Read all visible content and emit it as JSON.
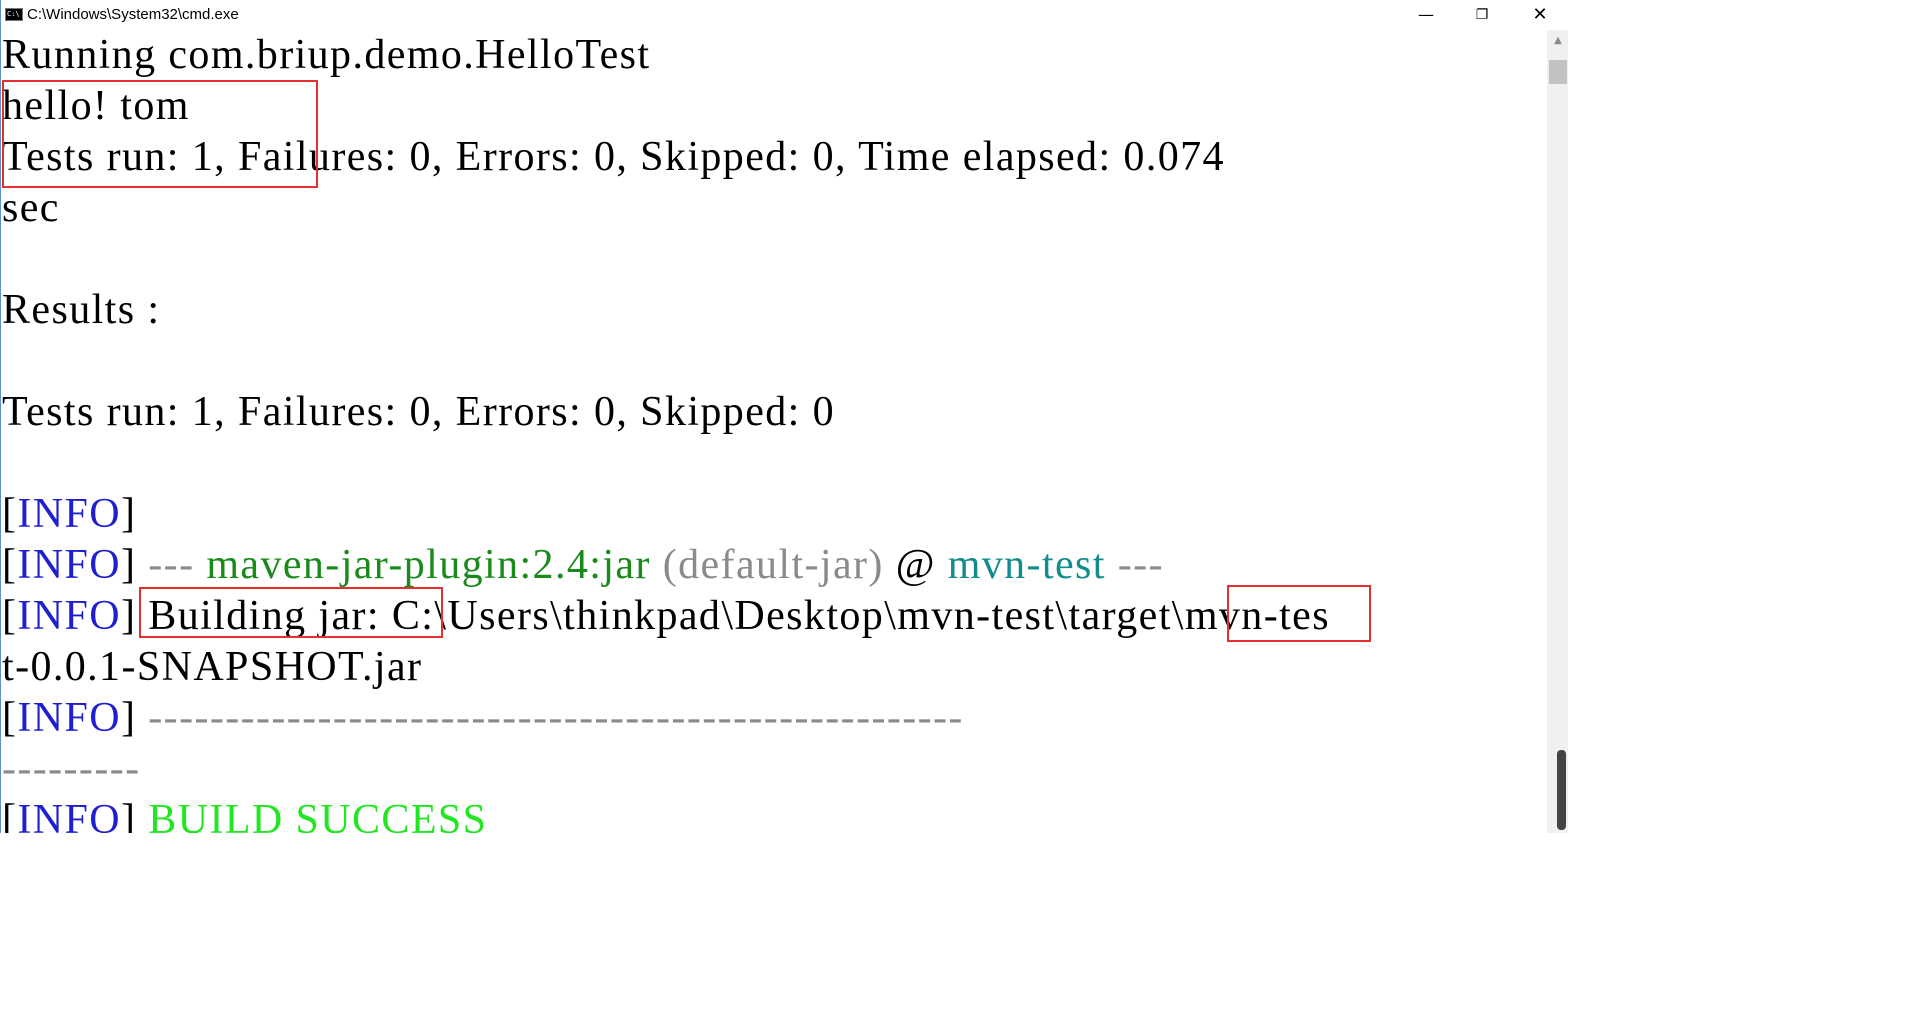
{
  "window": {
    "title": "C:\\Windows\\System32\\cmd.exe",
    "icon": "cmd-icon",
    "icon_glyph": "C:\\",
    "buttons": {
      "minimize": "—",
      "restore": "❐",
      "close": "✕"
    }
  },
  "console": {
    "lines": [
      {
        "text": "Running com.briup.demo.HelloTest"
      },
      {
        "text": "hello! tom"
      },
      {
        "text": "Tests run: 1, Failures: 0, Errors: 0, Skipped: 0, Time elapsed: 0.074"
      },
      {
        "text": "sec"
      },
      {
        "text": ""
      },
      {
        "text": "Results :"
      },
      {
        "text": ""
      },
      {
        "text": "Tests run: 1, Failures: 0, Errors: 0, Skipped: 0"
      },
      {
        "text": ""
      },
      {
        "prefix": "[",
        "tag": "INFO",
        "suffix": "]"
      },
      {
        "prefix": "[",
        "tag": "INFO",
        "suffix": "] ",
        "dashes_open": "--- ",
        "plugin": "maven-jar-plugin:2.4:jar",
        "execution": " (default-jar)",
        "at": " @ ",
        "project": "mvn-test",
        "dashes_close": " ---"
      },
      {
        "prefix": "[",
        "tag": "INFO",
        "suffix": "] ",
        "label": "Building jar:",
        "path_start": " C:\\Users\\thinkpad\\Desktop\\mvn-test\\",
        "path_highlight": "target",
        "path_end": "\\mvn-tes"
      },
      {
        "text": "t-0.0.1-SNAPSHOT.jar"
      },
      {
        "prefix": "[",
        "tag": "INFO",
        "suffix": "] ",
        "rule": "-----------------------------------------------------"
      },
      {
        "text": "---------"
      },
      {
        "prefix": "[",
        "tag": "INFO",
        "suffix": "] ",
        "status": "BUILD SUCCESS"
      }
    ]
  },
  "colors": {
    "info_tag": "#1f1fcf",
    "plugin": "#1a8a1a",
    "execution": "#8a8a8a",
    "project": "#138c8c",
    "build_success": "#22e622",
    "annotation_box": "#e53030",
    "window_border": "#5b8fd6"
  },
  "scrollbar": {
    "up_arrow": "▲"
  }
}
